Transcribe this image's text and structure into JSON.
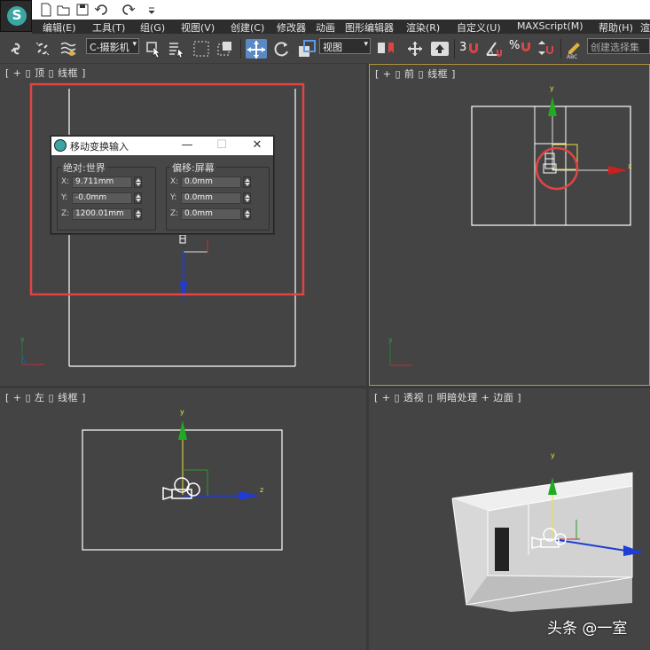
{
  "menu": {
    "items": [
      "编辑(E)",
      "工具(T)",
      "组(G)",
      "视图(V)",
      "创建(C)",
      "修改器",
      "动画",
      "图形编辑器",
      "渲染(R)",
      "自定义(U)",
      "MAXScript(M)",
      "帮助(H)",
      "渲"
    ]
  },
  "toolbar": {
    "selection_filter": "C-摄影机",
    "reference_coord": "视图",
    "snap_number": "3",
    "percent_symbol": "%",
    "named_selection_placeholder": "创建选择集"
  },
  "viewports": {
    "top": "[ + ▯ 顶 ▯ 线框 ]",
    "front": "[ + ▯ 前 ▯ 线框 ]",
    "left": "[ + ▯ 左 ▯ 线框 ]",
    "perspective": "[ + ▯ 透视 ▯ 明暗处理 + 边面 ]"
  },
  "axis_labels": {
    "x": "x",
    "y": "y",
    "z": "z"
  },
  "dialog": {
    "title": "移动变换输入",
    "absolute": {
      "title": "绝对:世界",
      "x_label": "X:",
      "x_value": "9.711mm",
      "y_label": "Y:",
      "y_value": "-0.0mm",
      "z_label": "Z:",
      "z_value": "1200.01mm"
    },
    "offset": {
      "title": "偏移:屏幕",
      "x_label": "X:",
      "x_value": "0.0mm",
      "y_label": "Y:",
      "y_value": "0.0mm",
      "z_label": "Z:",
      "z_value": "0.0mm"
    }
  },
  "annotation_colors": {
    "highlight": "#e04444",
    "active_viewport": "#b89a3a"
  },
  "watermark": "头条 @一室"
}
